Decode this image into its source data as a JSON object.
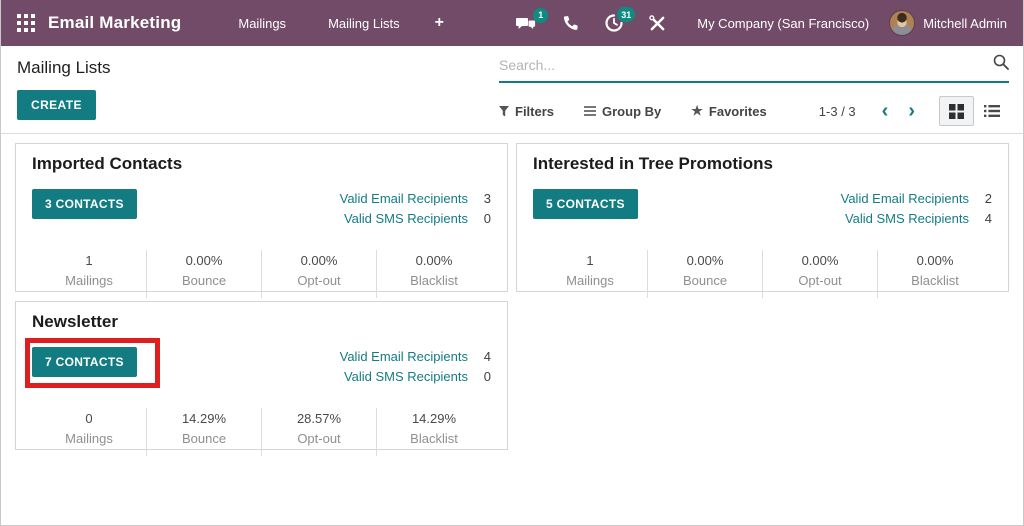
{
  "topbar": {
    "app_name": "Email Marketing",
    "menus": [
      {
        "label": "Mailings"
      },
      {
        "label": "Mailing Lists"
      }
    ],
    "plus_label": "+",
    "badges": {
      "messages": "1",
      "activities": "31"
    },
    "company": "My Company (San Francisco)",
    "user": "Mitchell Admin"
  },
  "control_panel": {
    "title": "Mailing Lists",
    "create_label": "CREATE",
    "search_placeholder": "Search...",
    "filters_label": "Filters",
    "groupby_label": "Group By",
    "favorites_label": "Favorites",
    "pager": "1-3 / 3",
    "prev_label": "‹",
    "next_label": "›"
  },
  "colors": {
    "topbar": "#714B67",
    "accent_teal": "#137C83",
    "badge_teal": "#0E8C82",
    "highlight_red": "#DF1F1F"
  },
  "cards": [
    {
      "title": "Imported Contacts",
      "contacts_label": "3 CONTACTS",
      "email_recipients_label": "Valid Email Recipients",
      "email_recipients_value": "3",
      "sms_recipients_label": "Valid SMS Recipients",
      "sms_recipients_value": "0",
      "highlighted": false,
      "stats": [
        {
          "value": "1",
          "label": "Mailings"
        },
        {
          "value": "0.00%",
          "label": "Bounce"
        },
        {
          "value": "0.00%",
          "label": "Opt-out"
        },
        {
          "value": "0.00%",
          "label": "Blacklist"
        }
      ]
    },
    {
      "title": "Interested in Tree Promotions",
      "contacts_label": "5 CONTACTS",
      "email_recipients_label": "Valid Email Recipients",
      "email_recipients_value": "2",
      "sms_recipients_label": "Valid SMS Recipients",
      "sms_recipients_value": "4",
      "highlighted": false,
      "stats": [
        {
          "value": "1",
          "label": "Mailings"
        },
        {
          "value": "0.00%",
          "label": "Bounce"
        },
        {
          "value": "0.00%",
          "label": "Opt-out"
        },
        {
          "value": "0.00%",
          "label": "Blacklist"
        }
      ]
    },
    {
      "title": "Newsletter",
      "contacts_label": "7 CONTACTS",
      "email_recipients_label": "Valid Email Recipients",
      "email_recipients_value": "4",
      "sms_recipients_label": "Valid SMS Recipients",
      "sms_recipients_value": "0",
      "highlighted": true,
      "stats": [
        {
          "value": "0",
          "label": "Mailings"
        },
        {
          "value": "14.29%",
          "label": "Bounce"
        },
        {
          "value": "28.57%",
          "label": "Opt-out"
        },
        {
          "value": "14.29%",
          "label": "Blacklist"
        }
      ]
    }
  ]
}
